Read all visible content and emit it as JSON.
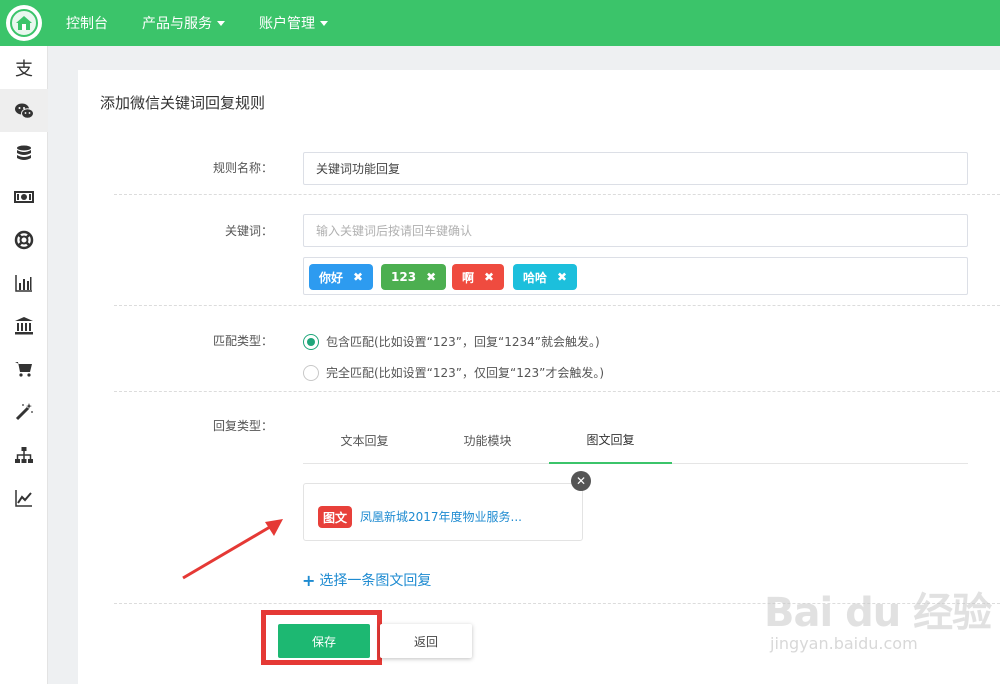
{
  "topbar": {
    "nav": [
      {
        "label": "控制台",
        "dropdown": false
      },
      {
        "label": "产品与服务",
        "dropdown": true
      },
      {
        "label": "账户管理",
        "dropdown": true
      }
    ]
  },
  "sidebar": {
    "items": [
      {
        "icon": "alipay-icon"
      },
      {
        "icon": "wechat-icon",
        "active": true
      },
      {
        "icon": "database-icon"
      },
      {
        "icon": "money-icon"
      },
      {
        "icon": "lifebuoy-icon"
      },
      {
        "icon": "bar-chart-icon"
      },
      {
        "icon": "bank-icon"
      },
      {
        "icon": "cart-icon"
      },
      {
        "icon": "magic-wand-icon"
      },
      {
        "icon": "sitemap-icon"
      },
      {
        "icon": "line-chart-icon"
      }
    ]
  },
  "form": {
    "title": "添加微信关键词回复规则",
    "rule_name_label": "规则名称：",
    "rule_name_value": "关键词功能回复",
    "keyword_label": "关键词：",
    "keyword_placeholder": "输入关键词后按请回车键确认",
    "tags": [
      {
        "text": "你好",
        "color": "#2d9bf0"
      },
      {
        "text": "123",
        "color": "#4caf50"
      },
      {
        "text": "啊",
        "color": "#ef4b3f"
      },
      {
        "text": "哈哈",
        "color": "#1cbfdc"
      }
    ],
    "match_label": "匹配类型：",
    "match_options": [
      {
        "text": "包含匹配(比如设置“123”，回复“1234”就会触发。)",
        "selected": true
      },
      {
        "text": "完全匹配(比如设置“123”，仅回复“123”才会触发。)",
        "selected": false
      }
    ],
    "reply_label": "回复类型：",
    "reply_tabs": [
      {
        "label": "文本回复",
        "active": false
      },
      {
        "label": "功能模块",
        "active": false
      },
      {
        "label": "图文回复",
        "active": true
      }
    ],
    "news_badge": "图文",
    "news_title": "凤凰新城2017年度物业服务...",
    "add_news": "选择一条图文回复",
    "save": "保存",
    "back": "返回"
  },
  "watermark": {
    "logo": "Bai du 经验",
    "url": "jingyan.baidu.com"
  },
  "colors": {
    "topbar": "#3bc46a",
    "save": "#1db872",
    "highlight": "#e53935",
    "link": "#1e8bd1"
  }
}
